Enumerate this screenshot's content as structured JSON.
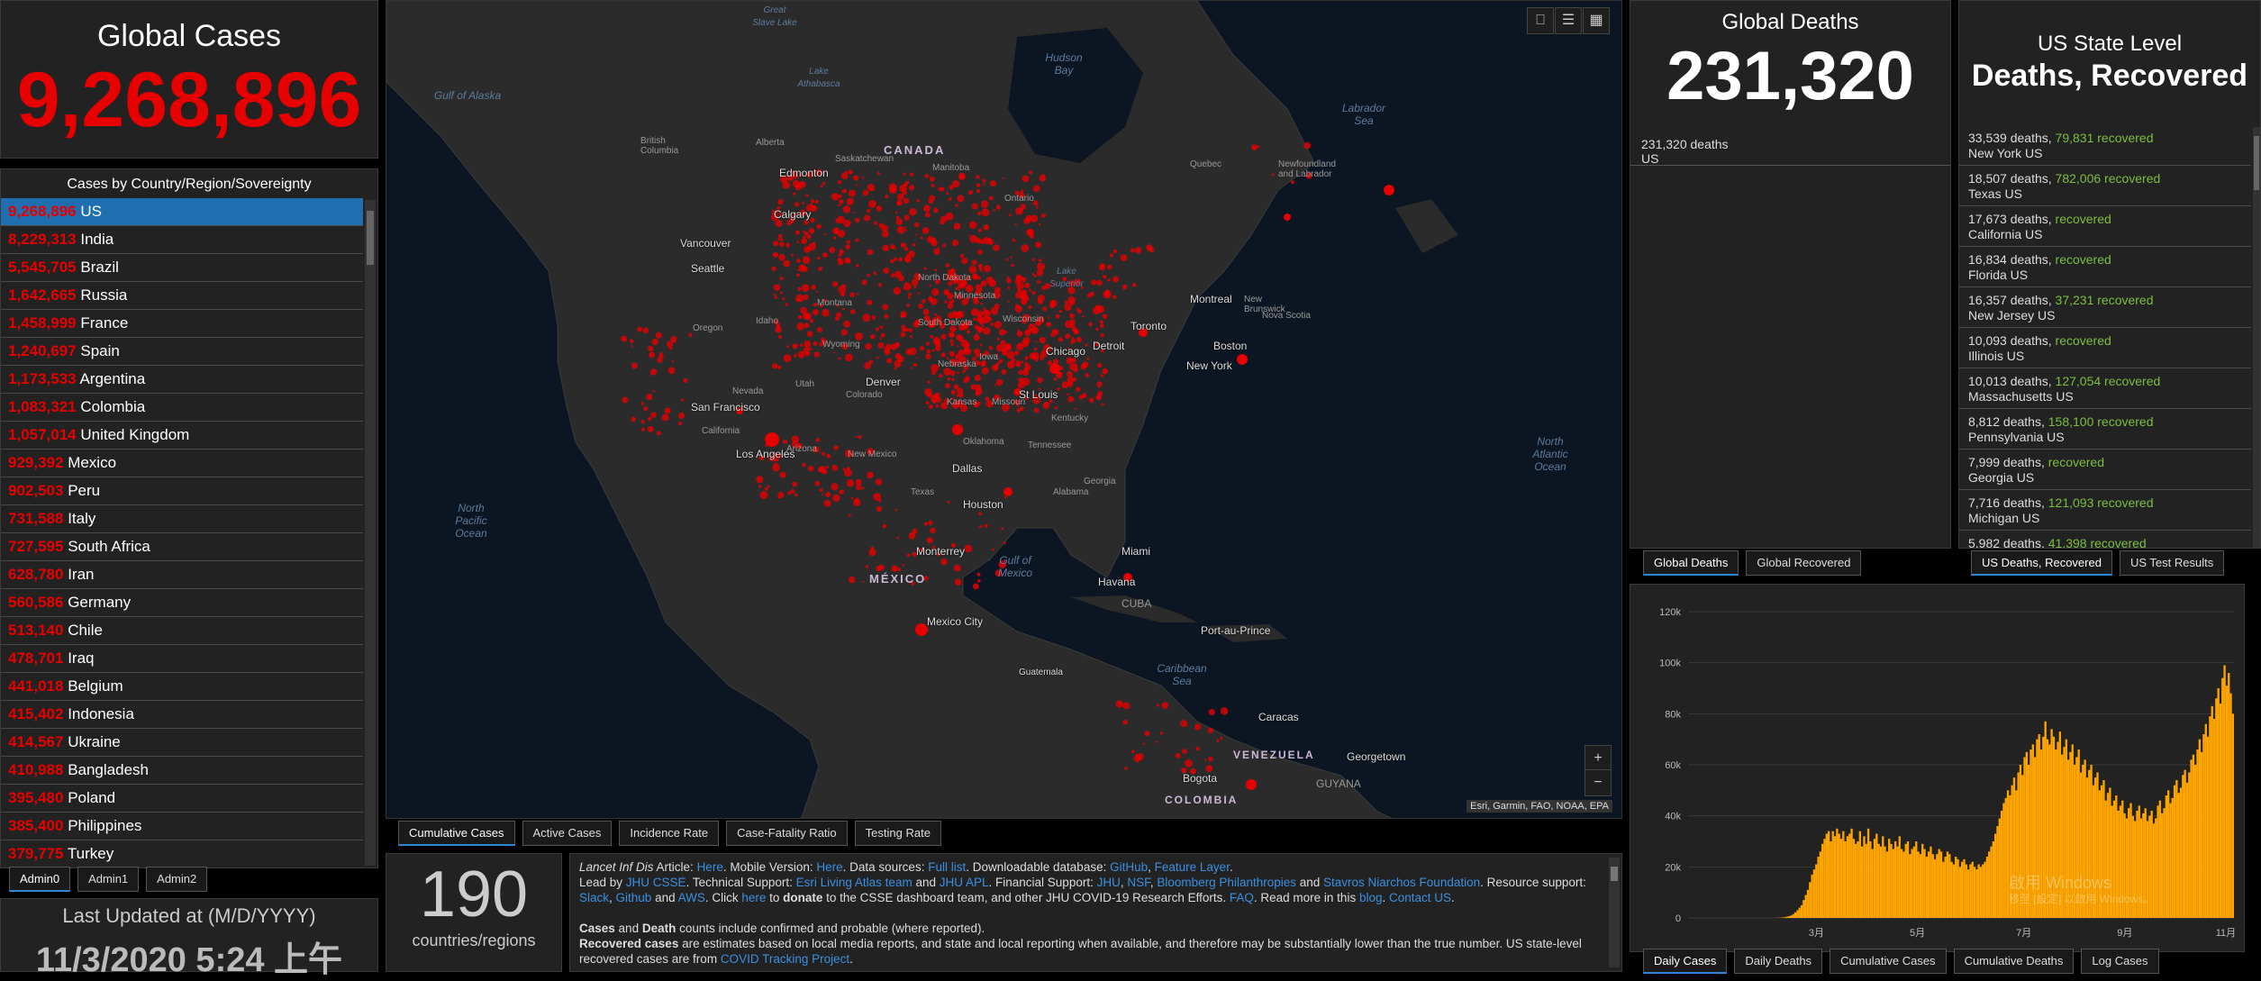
{
  "global_cases": {
    "label": "Global Cases",
    "value": "9,268,896"
  },
  "country_list": {
    "title": "Cases by Country/Region/Sovereignty",
    "rows": [
      {
        "count": "9,268,896",
        "name": "US"
      },
      {
        "count": "8,229,313",
        "name": "India"
      },
      {
        "count": "5,545,705",
        "name": "Brazil"
      },
      {
        "count": "1,642,665",
        "name": "Russia"
      },
      {
        "count": "1,458,999",
        "name": "France"
      },
      {
        "count": "1,240,697",
        "name": "Spain"
      },
      {
        "count": "1,173,533",
        "name": "Argentina"
      },
      {
        "count": "1,083,321",
        "name": "Colombia"
      },
      {
        "count": "1,057,014",
        "name": "United Kingdom"
      },
      {
        "count": "929,392",
        "name": "Mexico"
      },
      {
        "count": "902,503",
        "name": "Peru"
      },
      {
        "count": "731,588",
        "name": "Italy"
      },
      {
        "count": "727,595",
        "name": "South Africa"
      },
      {
        "count": "628,780",
        "name": "Iran"
      },
      {
        "count": "560,586",
        "name": "Germany"
      },
      {
        "count": "513,140",
        "name": "Chile"
      },
      {
        "count": "478,701",
        "name": "Iraq"
      },
      {
        "count": "441,018",
        "name": "Belgium"
      },
      {
        "count": "415,402",
        "name": "Indonesia"
      },
      {
        "count": "414,567",
        "name": "Ukraine"
      },
      {
        "count": "410,988",
        "name": "Bangladesh"
      },
      {
        "count": "395,480",
        "name": "Poland"
      },
      {
        "count": "385,400",
        "name": "Philippines"
      },
      {
        "count": "379,775",
        "name": "Turkey"
      }
    ]
  },
  "admin_tabs": [
    "Admin0",
    "Admin1",
    "Admin2"
  ],
  "last_updated": {
    "label": "Last Updated at (M/D/YYYY)",
    "value": "11/3/2020 5:24 上午"
  },
  "map": {
    "countries": [
      "CANADA",
      "MÉXICO",
      "CUBA",
      "VENEZUELA",
      "GUYANA",
      "COLOMBIA"
    ],
    "seas": [
      "Gulf of Alaska",
      "Hudson Bay",
      "Labrador Sea",
      "North Pacific Ocean",
      "North Atlantic Ocean",
      "Gulf of Mexico",
      "Caribbean Sea",
      "Great Slave Lake",
      "Lake Athabasca",
      "Lake Superior"
    ],
    "cities": [
      "Vancouver",
      "Calgary",
      "Edmonton",
      "Seattle",
      "San Francisco",
      "Los Angeles",
      "Denver",
      "Chicago",
      "Detroit",
      "Toronto",
      "Montreal",
      "Boston",
      "New York",
      "St Louis",
      "Dallas",
      "Houston",
      "Miami",
      "Havana",
      "Monterrey",
      "Mexico City",
      "Guatemala",
      "Port-au-Prince",
      "Caracas",
      "Bogota",
      "Georgetown"
    ],
    "regions": [
      "British Columbia",
      "Alberta",
      "Saskatchewan",
      "Manitoba",
      "Ontario",
      "Quebec",
      "Newfoundland and Labrador",
      "Oregon",
      "Idaho",
      "Montana",
      "Nevada",
      "Utah",
      "California",
      "Arizona",
      "Wyoming",
      "Colorado",
      "New Mexico",
      "North Dakota",
      "South Dakota",
      "Nebraska",
      "Kansas",
      "Oklahoma",
      "Texas",
      "Minnesota",
      "Iowa",
      "Missouri",
      "Wisconsin",
      "Kentucky",
      "Tennessee",
      "Georgia",
      "Alabama",
      "New Brunswick",
      "Nova Scotia"
    ],
    "attribution": "Esri, Garmin, FAO, NOAA, EPA"
  },
  "map_tabs": [
    "Cumulative Cases",
    "Active Cases",
    "Incidence Rate",
    "Case-Fatality Ratio",
    "Testing Rate"
  ],
  "regions_count": {
    "value": "190",
    "label": "countries/regions"
  },
  "info_text": {
    "l1a": "Lancet Inf Dis",
    "l1b": " Article: ",
    "l1c": "Here",
    "l1d": ". Mobile Version: ",
    "l1e": "Here",
    "l1f": ". Data sources: ",
    "l1g": "Full list",
    "l1h": ". Downloadable database: ",
    "l1i": "GitHub",
    "l1j": ", ",
    "l1k": "Feature Layer",
    "l1l": ".",
    "l2a": "Lead by ",
    "l2b": "JHU CSSE",
    "l2c": ". Technical Support: ",
    "l2d": "Esri Living Atlas team",
    "l2e": " and ",
    "l2f": "JHU APL",
    "l2g": ". Financial Support: ",
    "l2h": "JHU",
    "l2i": ", ",
    "l2j": "NSF",
    "l2k": ", ",
    "l2l": "Bloomberg Philanthropies",
    "l2m": " and ",
    "l2n": "Stavros Niarchos Foundation",
    "l2o": ". Resource support: ",
    "l2p": "Slack",
    "l2q": ", ",
    "l2r": "Github",
    "l2s": " and ",
    "l2t": "AWS",
    "l2u": ". Click ",
    "l2v": "here",
    "l2w": " to ",
    "l2x": "donate",
    "l2y": " to the CSSE dashboard team, and other JHU COVID-19 Research Efforts. ",
    "l2z": "FAQ",
    "l2aa": ". Read more in this ",
    "l2ab": "blog",
    "l2ac": ". ",
    "l2ad": "Contact US",
    "l2ae": ".",
    "l3a": "Cases",
    "l3b": " and ",
    "l3c": "Death",
    "l3d": " counts include confirmed and probable (where reported).",
    "l4a": "Recovered cases",
    "l4b": " are estimates based on local media reports, and state and local reporting when available, and therefore may be substantially lower than the true number. US state-level recovered cases are from ",
    "l4c": "COVID Tracking Project",
    "l4d": "."
  },
  "global_deaths": {
    "label": "Global Deaths",
    "value": "231,320",
    "sub_count": "231,320 deaths",
    "sub_name": "US"
  },
  "deaths_tabs": [
    "Global Deaths",
    "Global Recovered"
  ],
  "state_panel": {
    "title": "US State Level",
    "subtitle": "Deaths, Recovered",
    "rows": [
      {
        "deaths": "33,539 deaths, ",
        "recovered": "79,831",
        "suffix": " recovered",
        "name": "New York US"
      },
      {
        "deaths": "18,507 deaths, ",
        "recovered": "782,006",
        "suffix": " recovered",
        "name": "Texas US"
      },
      {
        "deaths": "17,673 deaths, ",
        "recovered": "",
        "suffix": " recovered",
        "name": "California US"
      },
      {
        "deaths": "16,834 deaths, ",
        "recovered": "",
        "suffix": " recovered",
        "name": "Florida US"
      },
      {
        "deaths": "16,357 deaths, ",
        "recovered": "37,231",
        "suffix": " recovered",
        "name": "New Jersey US"
      },
      {
        "deaths": "10,093 deaths, ",
        "recovered": "",
        "suffix": " recovered",
        "name": "Illinois US"
      },
      {
        "deaths": "10,013 deaths, ",
        "recovered": "127,054",
        "suffix": " recovered",
        "name": "Massachusetts US"
      },
      {
        "deaths": "8,812 deaths, ",
        "recovered": "158,100",
        "suffix": " recovered",
        "name": "Pennsylvania US"
      },
      {
        "deaths": "7,999 deaths, ",
        "recovered": "",
        "suffix": " recovered",
        "name": "Georgia US"
      },
      {
        "deaths": "7,716 deaths, ",
        "recovered": "121,093",
        "suffix": " recovered",
        "name": "Michigan US"
      },
      {
        "deaths": "5,982 deaths, ",
        "recovered": "41,398",
        "suffix": " recovered",
        "name": ""
      }
    ]
  },
  "state_tabs": [
    "US Deaths, Recovered",
    "US Test Results"
  ],
  "chart_tabs": [
    "Daily Cases",
    "Daily Deaths",
    "Cumulative Cases",
    "Cumulative Deaths",
    "Log Cases"
  ],
  "watermark": {
    "line1": "啟用 Windows",
    "line2": "移至 [設定] 以啟用 Windows。"
  },
  "chart_data": {
    "type": "bar",
    "x_ticks": [
      "3月",
      "5月",
      "7月",
      "9月",
      "11月"
    ],
    "y_ticks": [
      "0",
      "20k",
      "40k",
      "60k",
      "80k",
      "100k",
      "120k"
    ],
    "ylim": [
      0,
      120000
    ],
    "bar_color": "#ffa500",
    "values": [
      0,
      0,
      0,
      0,
      0,
      0,
      0,
      0,
      0,
      0,
      0,
      0,
      0,
      0,
      0,
      0,
      0,
      0,
      0,
      0,
      0,
      0,
      0,
      0,
      0,
      0,
      0,
      0,
      0,
      0,
      0,
      0,
      0,
      0,
      0,
      0,
      0,
      0,
      0,
      0,
      5,
      10,
      30,
      60,
      100,
      200,
      300,
      500,
      700,
      1000,
      1500,
      2200,
      3000,
      4000,
      5000,
      7000,
      9000,
      11000,
      14000,
      17000,
      19000,
      21000,
      24000,
      26000,
      29000,
      31000,
      33000,
      34000,
      30000,
      34000,
      32000,
      35000,
      33000,
      31000,
      34000,
      30000,
      32000,
      33000,
      35000,
      31000,
      29000,
      30000,
      34000,
      28000,
      32000,
      29000,
      35000,
      30000,
      27000,
      31000,
      33000,
      29000,
      28000,
      32000,
      28000,
      26000,
      31000,
      29000,
      27000,
      30000,
      28000,
      32000,
      27000,
      26000,
      29000,
      30000,
      25000,
      27000,
      28000,
      30000,
      26000,
      25000,
      29000,
      27000,
      24000,
      26000,
      28000,
      25000,
      23000,
      25000,
      27000,
      26000,
      22000,
      24000,
      26000,
      25000,
      22000,
      21000,
      24000,
      23000,
      20000,
      22000,
      23000,
      21000,
      19000,
      21000,
      22000,
      20000,
      19000,
      21000,
      20000,
      21000,
      22000,
      24000,
      26000,
      28000,
      30000,
      33000,
      36000,
      39000,
      42000,
      45000,
      47000,
      50000,
      48000,
      52000,
      55000,
      50000,
      57000,
      60000,
      56000,
      63000,
      65000,
      60000,
      66000,
      68000,
      63000,
      70000,
      72000,
      66000,
      71000,
      77000,
      70000,
      68000,
      74000,
      71000,
      66000,
      69000,
      73000,
      64000,
      67000,
      70000,
      62000,
      65000,
      68000,
      60000,
      63000,
      66000,
      57000,
      60000,
      62000,
      55000,
      58000,
      60000,
      52000,
      55000,
      57000,
      50000,
      52000,
      54000,
      46000,
      49000,
      51000,
      44000,
      46000,
      48000,
      42000,
      44000,
      46000,
      41000,
      39000,
      43000,
      45000,
      40000,
      38000,
      42000,
      44000,
      39000,
      41000,
      43000,
      38000,
      40000,
      42000,
      37000,
      39000,
      44000,
      46000,
      41000,
      43000,
      48000,
      50000,
      45000,
      47000,
      52000,
      54000,
      49000,
      51000,
      56000,
      58000,
      53000,
      57000,
      62000,
      64000,
      60000,
      66000,
      70000,
      65000,
      72000,
      76000,
      71000,
      79000,
      83000,
      78000,
      86000,
      90000,
      84000,
      94000,
      99000,
      91000,
      96000,
      88000,
      80000
    ]
  }
}
